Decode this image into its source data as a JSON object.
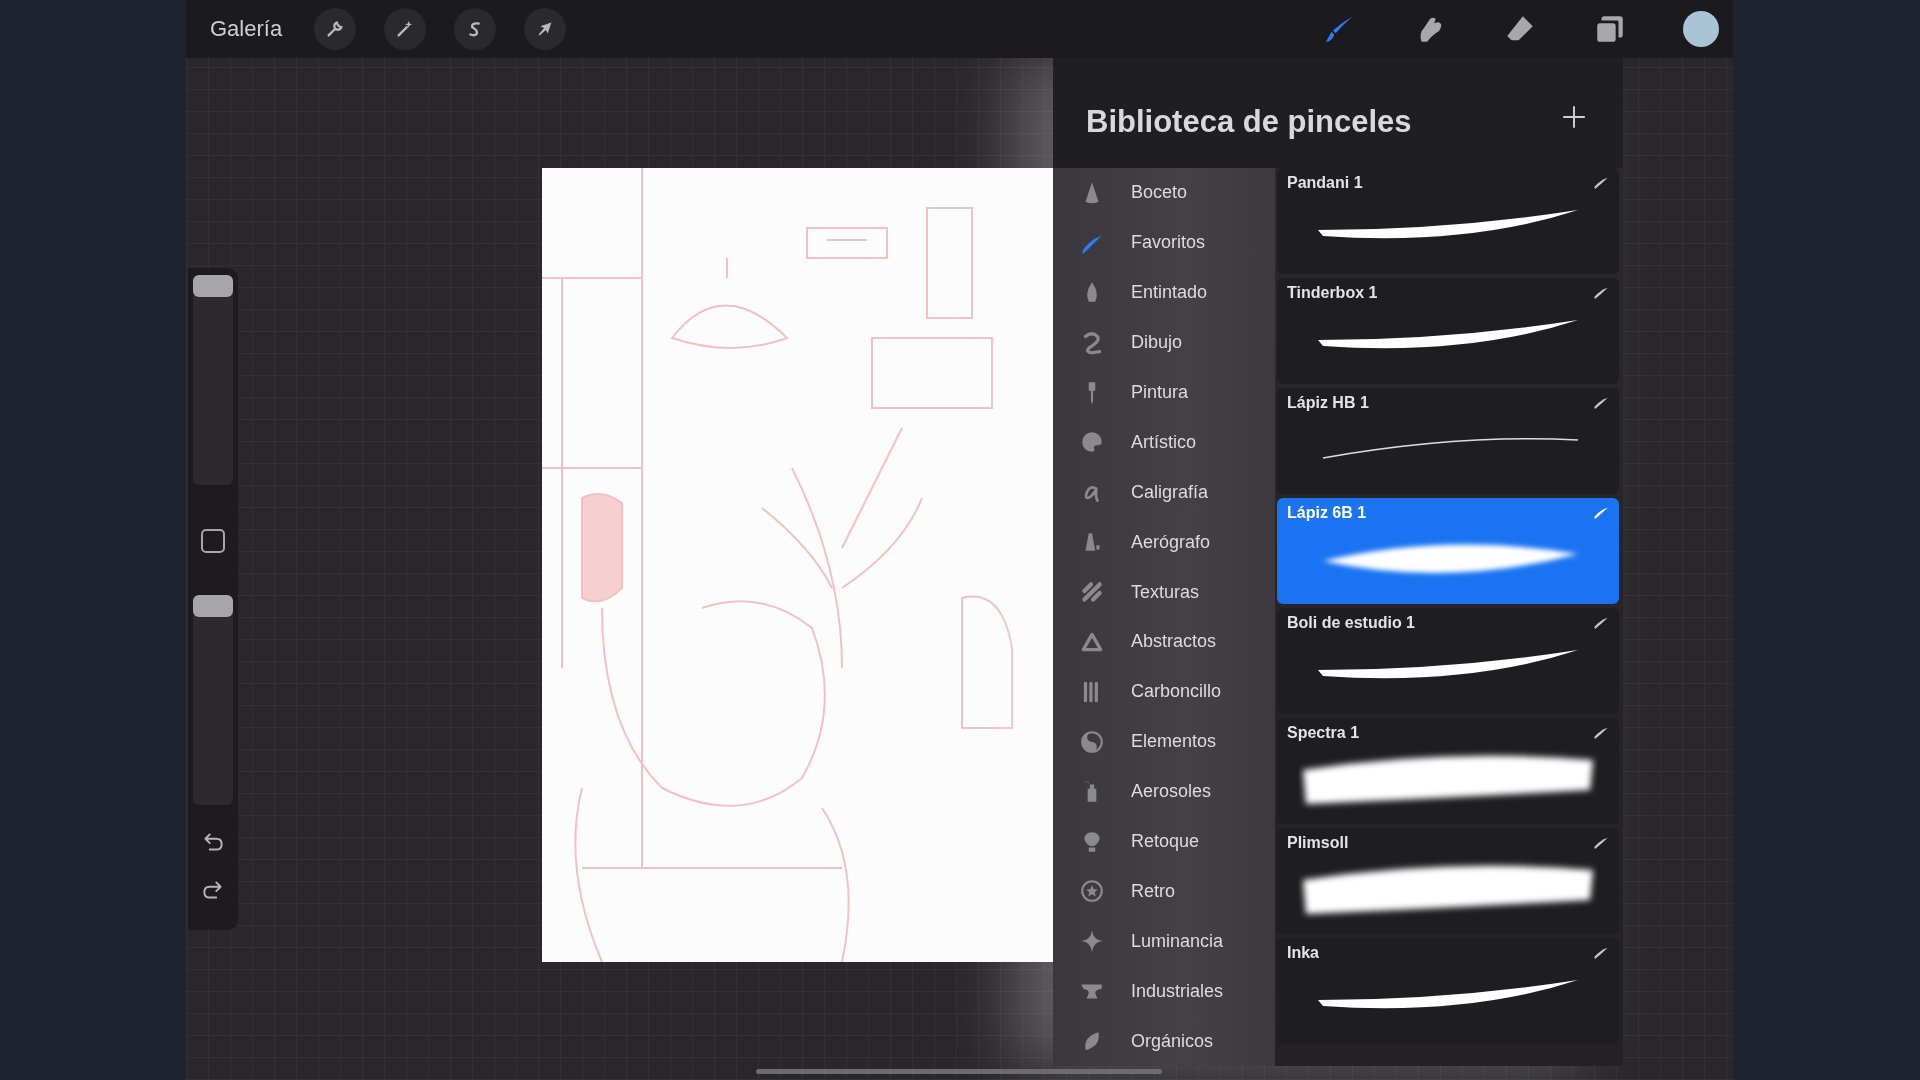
{
  "toolbar": {
    "gallery": "Galería",
    "tools": [
      {
        "kind": "wrench",
        "selected": false
      },
      {
        "kind": "wand",
        "selected": false
      },
      {
        "kind": "selection",
        "selected": false
      },
      {
        "kind": "transform",
        "selected": false
      }
    ],
    "paint_tools": [
      {
        "kind": "brush",
        "selected": true
      },
      {
        "kind": "smudge",
        "selected": false
      },
      {
        "kind": "eraser",
        "selected": false
      },
      {
        "kind": "layers",
        "selected": false
      }
    ],
    "color": "#a9c4d6"
  },
  "sidebar": {
    "size_slider": {
      "level": 1
    },
    "opacity_slider": {
      "level": 1
    }
  },
  "brush_library": {
    "title": "Biblioteca de pinceles",
    "categories": [
      {
        "label": "Boceto",
        "selected": false
      },
      {
        "label": "Favoritos",
        "selected": true
      },
      {
        "label": "Entintado",
        "selected": false
      },
      {
        "label": "Dibujo",
        "selected": false
      },
      {
        "label": "Pintura",
        "selected": false
      },
      {
        "label": "Artístico",
        "selected": false
      },
      {
        "label": "Caligrafía",
        "selected": false
      },
      {
        "label": "Aerógrafo",
        "selected": false
      },
      {
        "label": "Texturas",
        "selected": false
      },
      {
        "label": "Abstractos",
        "selected": false
      },
      {
        "label": "Carboncillo",
        "selected": false
      },
      {
        "label": "Elementos",
        "selected": false
      },
      {
        "label": "Aerosoles",
        "selected": false
      },
      {
        "label": "Retoque",
        "selected": false
      },
      {
        "label": "Retro",
        "selected": false
      },
      {
        "label": "Luminancia",
        "selected": false
      },
      {
        "label": "Industriales",
        "selected": false
      },
      {
        "label": "Orgánicos",
        "selected": false
      }
    ],
    "brushes": [
      {
        "name": "Pandani 1",
        "kind": "taper",
        "selected": false
      },
      {
        "name": "Tinderbox 1",
        "kind": "taper",
        "selected": false
      },
      {
        "name": "Lápiz HB 1",
        "kind": "line",
        "selected": false
      },
      {
        "name": "Lápiz 6B 1",
        "kind": "soft",
        "selected": true
      },
      {
        "name": "Boli de estudio 1",
        "kind": "taper",
        "selected": false
      },
      {
        "name": "Spectra 1",
        "kind": "wide",
        "selected": false
      },
      {
        "name": "Plimsoll",
        "kind": "wide",
        "selected": false
      },
      {
        "name": "Inka",
        "kind": "taper",
        "selected": false
      }
    ]
  }
}
